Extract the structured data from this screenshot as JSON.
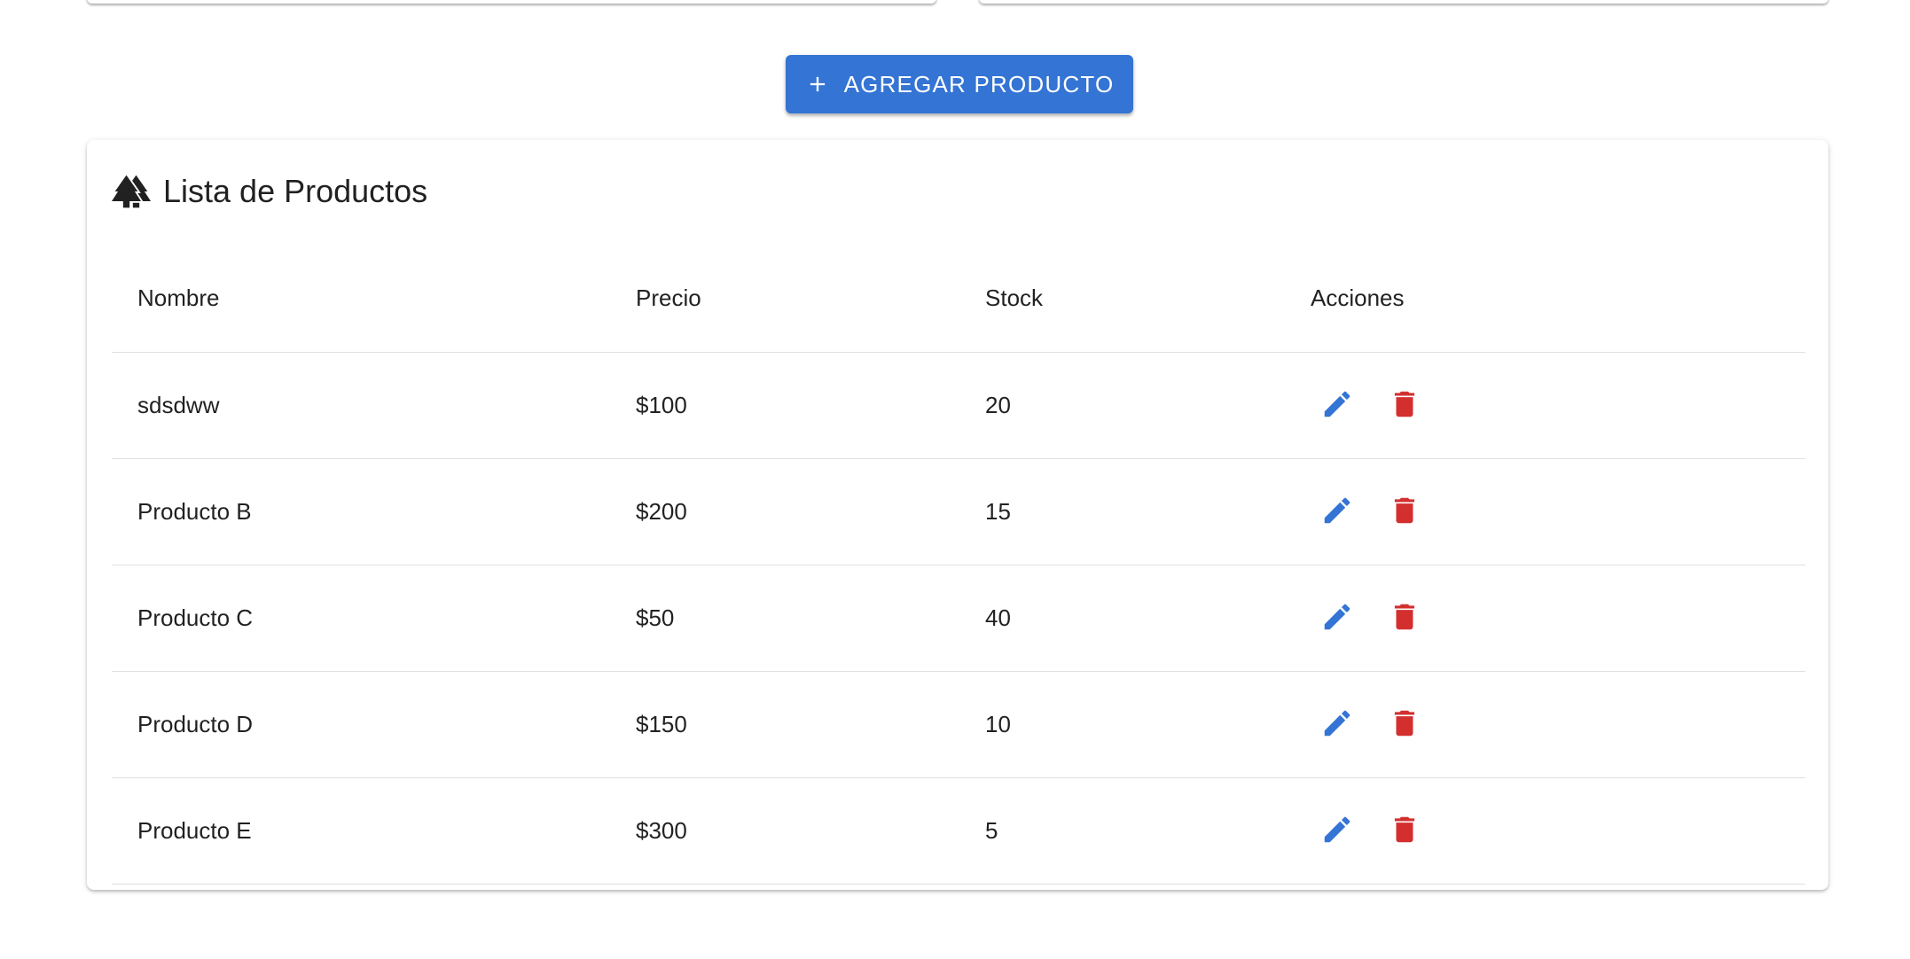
{
  "add_button": {
    "label": "AGREGAR PRODUCTO",
    "icon": "plus-icon",
    "color": "#3474d4"
  },
  "product_list": {
    "title": "Lista de Productos",
    "title_icon": "tree-icon",
    "columns": [
      "Nombre",
      "Precio",
      "Stock",
      "Acciones"
    ],
    "rows": [
      {
        "name": "sdsdww",
        "price": "$100",
        "stock": "20"
      },
      {
        "name": "Producto B",
        "price": "$200",
        "stock": "15"
      },
      {
        "name": "Producto C",
        "price": "$50",
        "stock": "40"
      },
      {
        "name": "Producto D",
        "price": "$150",
        "stock": "10"
      },
      {
        "name": "Producto E",
        "price": "$300",
        "stock": "5"
      }
    ],
    "row_actions": [
      {
        "icon": "pencil-icon",
        "color": "#3474d4"
      },
      {
        "icon": "trash-icon",
        "color": "#d32f2f"
      }
    ]
  }
}
